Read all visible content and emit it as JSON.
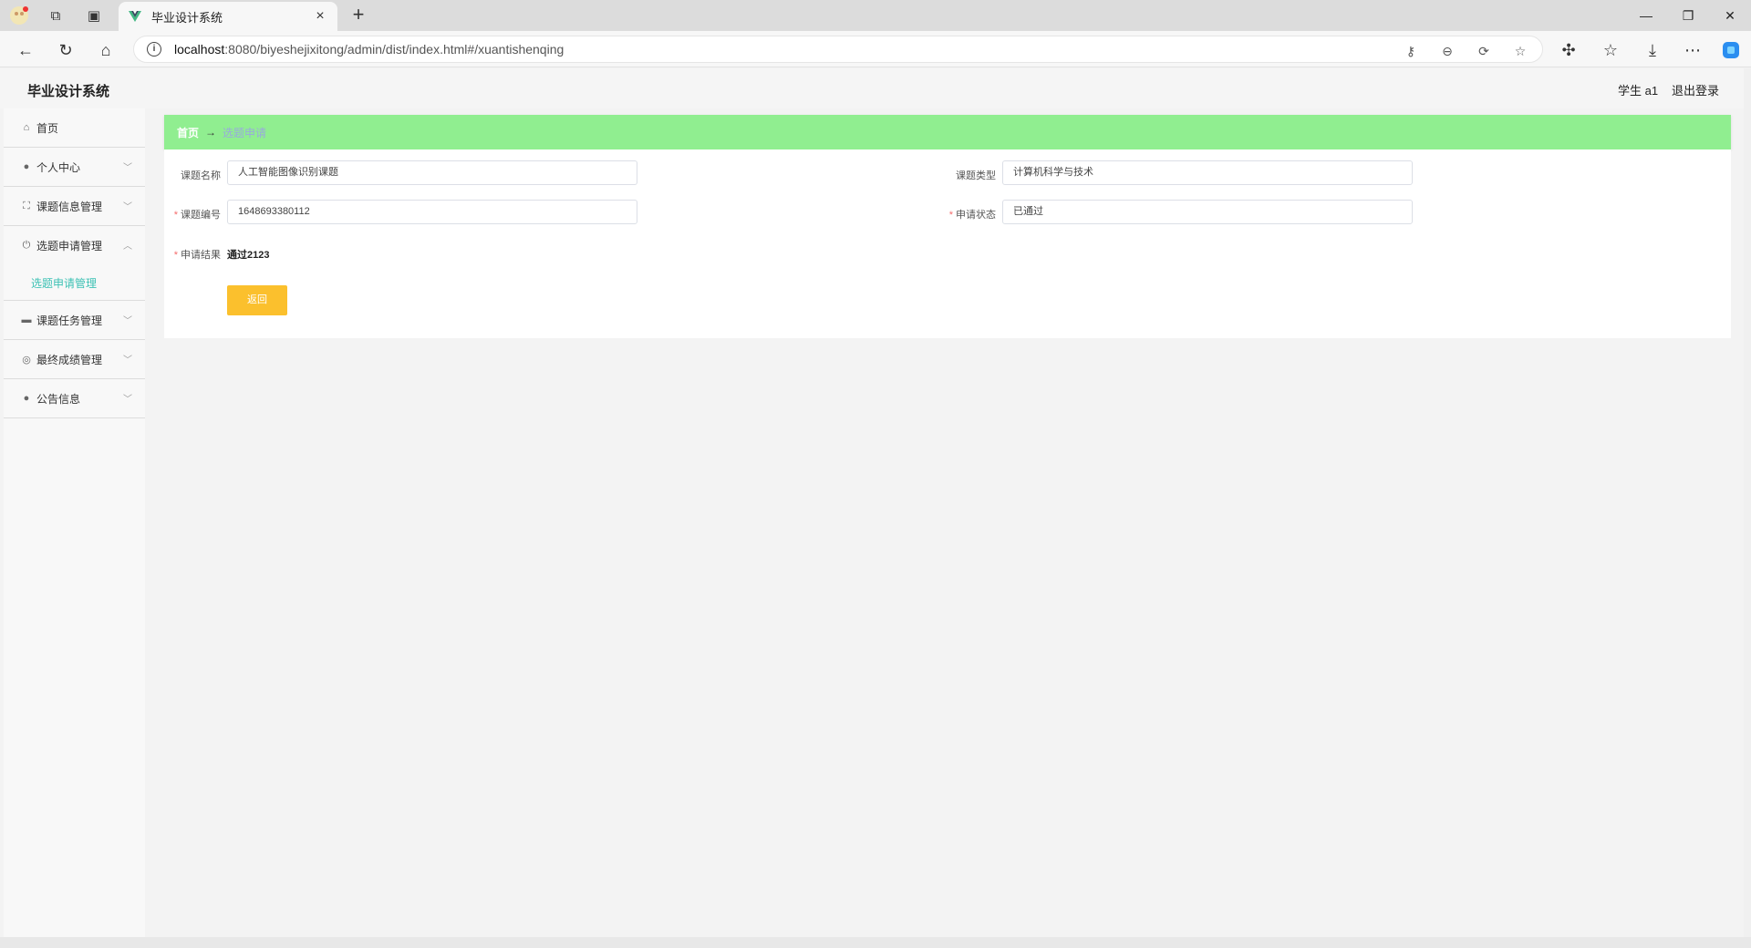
{
  "browser": {
    "tab_title": "毕业设计系统",
    "url_host": "localhost",
    "url_path": ":8080/biyeshejixitong/admin/dist/index.html#/xuantishenqing"
  },
  "header": {
    "app_title": "毕业设计系统",
    "user": "学生 a1",
    "logout": "退出登录"
  },
  "sidebar": {
    "items": [
      {
        "label": "首页",
        "icon": "home-icon"
      },
      {
        "label": "个人中心",
        "icon": "user-icon"
      },
      {
        "label": "课题信息管理",
        "icon": "expand-icon"
      },
      {
        "label": "选题申请管理",
        "icon": "power-icon"
      },
      {
        "label": "课题任务管理",
        "icon": "briefcase-icon"
      },
      {
        "label": "最终成绩管理",
        "icon": "target-icon"
      },
      {
        "label": "公告信息",
        "icon": "user-icon"
      }
    ],
    "submenu": {
      "label": "选题申请管理"
    }
  },
  "breadcrumb": {
    "home": "首页",
    "sep": "→",
    "current": "选题申请"
  },
  "form": {
    "topic_name_label": "课题名称",
    "topic_name_value": "人工智能图像识别课题",
    "topic_type_label": "课题类型",
    "topic_type_value": "计算机科学与技术",
    "topic_no_label": "课题编号",
    "topic_no_value": "1648693380112",
    "status_label": "申请状态",
    "status_value": "已通过",
    "result_label": "申请结果",
    "result_value": "通过2123",
    "back_button": "返回"
  },
  "colors": {
    "breadcrumb_bg": "#90ee90",
    "accent": "#3cc1b4",
    "button": "#fbc02d",
    "required": "#f56c6c"
  }
}
